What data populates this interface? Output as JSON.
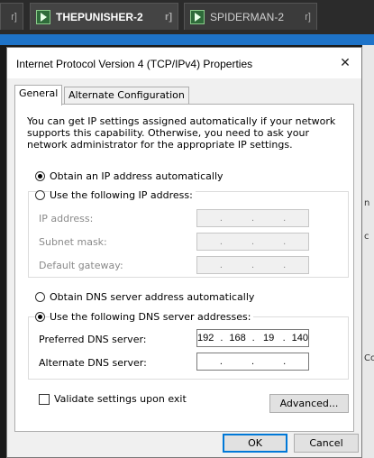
{
  "background": {
    "tabs": [
      {
        "label": "r]",
        "mark": ""
      },
      {
        "label": "THEPUNISHER-2",
        "mark": "r]"
      },
      {
        "label": "SPIDERMAN-2",
        "mark": "r]"
      }
    ],
    "peek_texts": [
      "n",
      "c",
      "Co"
    ]
  },
  "dialog": {
    "title": "Internet Protocol Version 4 (TCP/IPv4) Properties",
    "close_glyph": "✕",
    "tabs": [
      "General",
      "Alternate Configuration"
    ],
    "description": "You can get IP settings assigned automatically if your network supports this capability. Otherwise, you need to ask your network administrator for the appropriate IP settings.",
    "ip_auto_label": "Obtain an IP address automatically",
    "ip_manual_label": "Use the following IP address:",
    "ip_fields": [
      {
        "label": "IP address:",
        "value": [
          ".",
          ".",
          "."
        ]
      },
      {
        "label": "Subnet mask:",
        "value": [
          ".",
          ".",
          "."
        ]
      },
      {
        "label": "Default gateway:",
        "value": [
          ".",
          ".",
          "."
        ]
      }
    ],
    "dns_auto_label": "Obtain DNS server address automatically",
    "dns_manual_label": "Use the following DNS server addresses:",
    "preferred_dns_label": "Preferred DNS server:",
    "preferred_dns_parts": [
      "192",
      ".",
      "168",
      ".",
      "19",
      ".",
      "140"
    ],
    "alternate_dns_label": "Alternate DNS server:",
    "alternate_dns_parts": [
      ".",
      ".",
      "."
    ],
    "validate_label": "Validate settings upon exit",
    "advanced_label": "Advanced...",
    "ok_label": "OK",
    "cancel_label": "Cancel"
  },
  "colors": {
    "accent": "#0078d7",
    "taskbar_blue": "#1e73c8"
  }
}
